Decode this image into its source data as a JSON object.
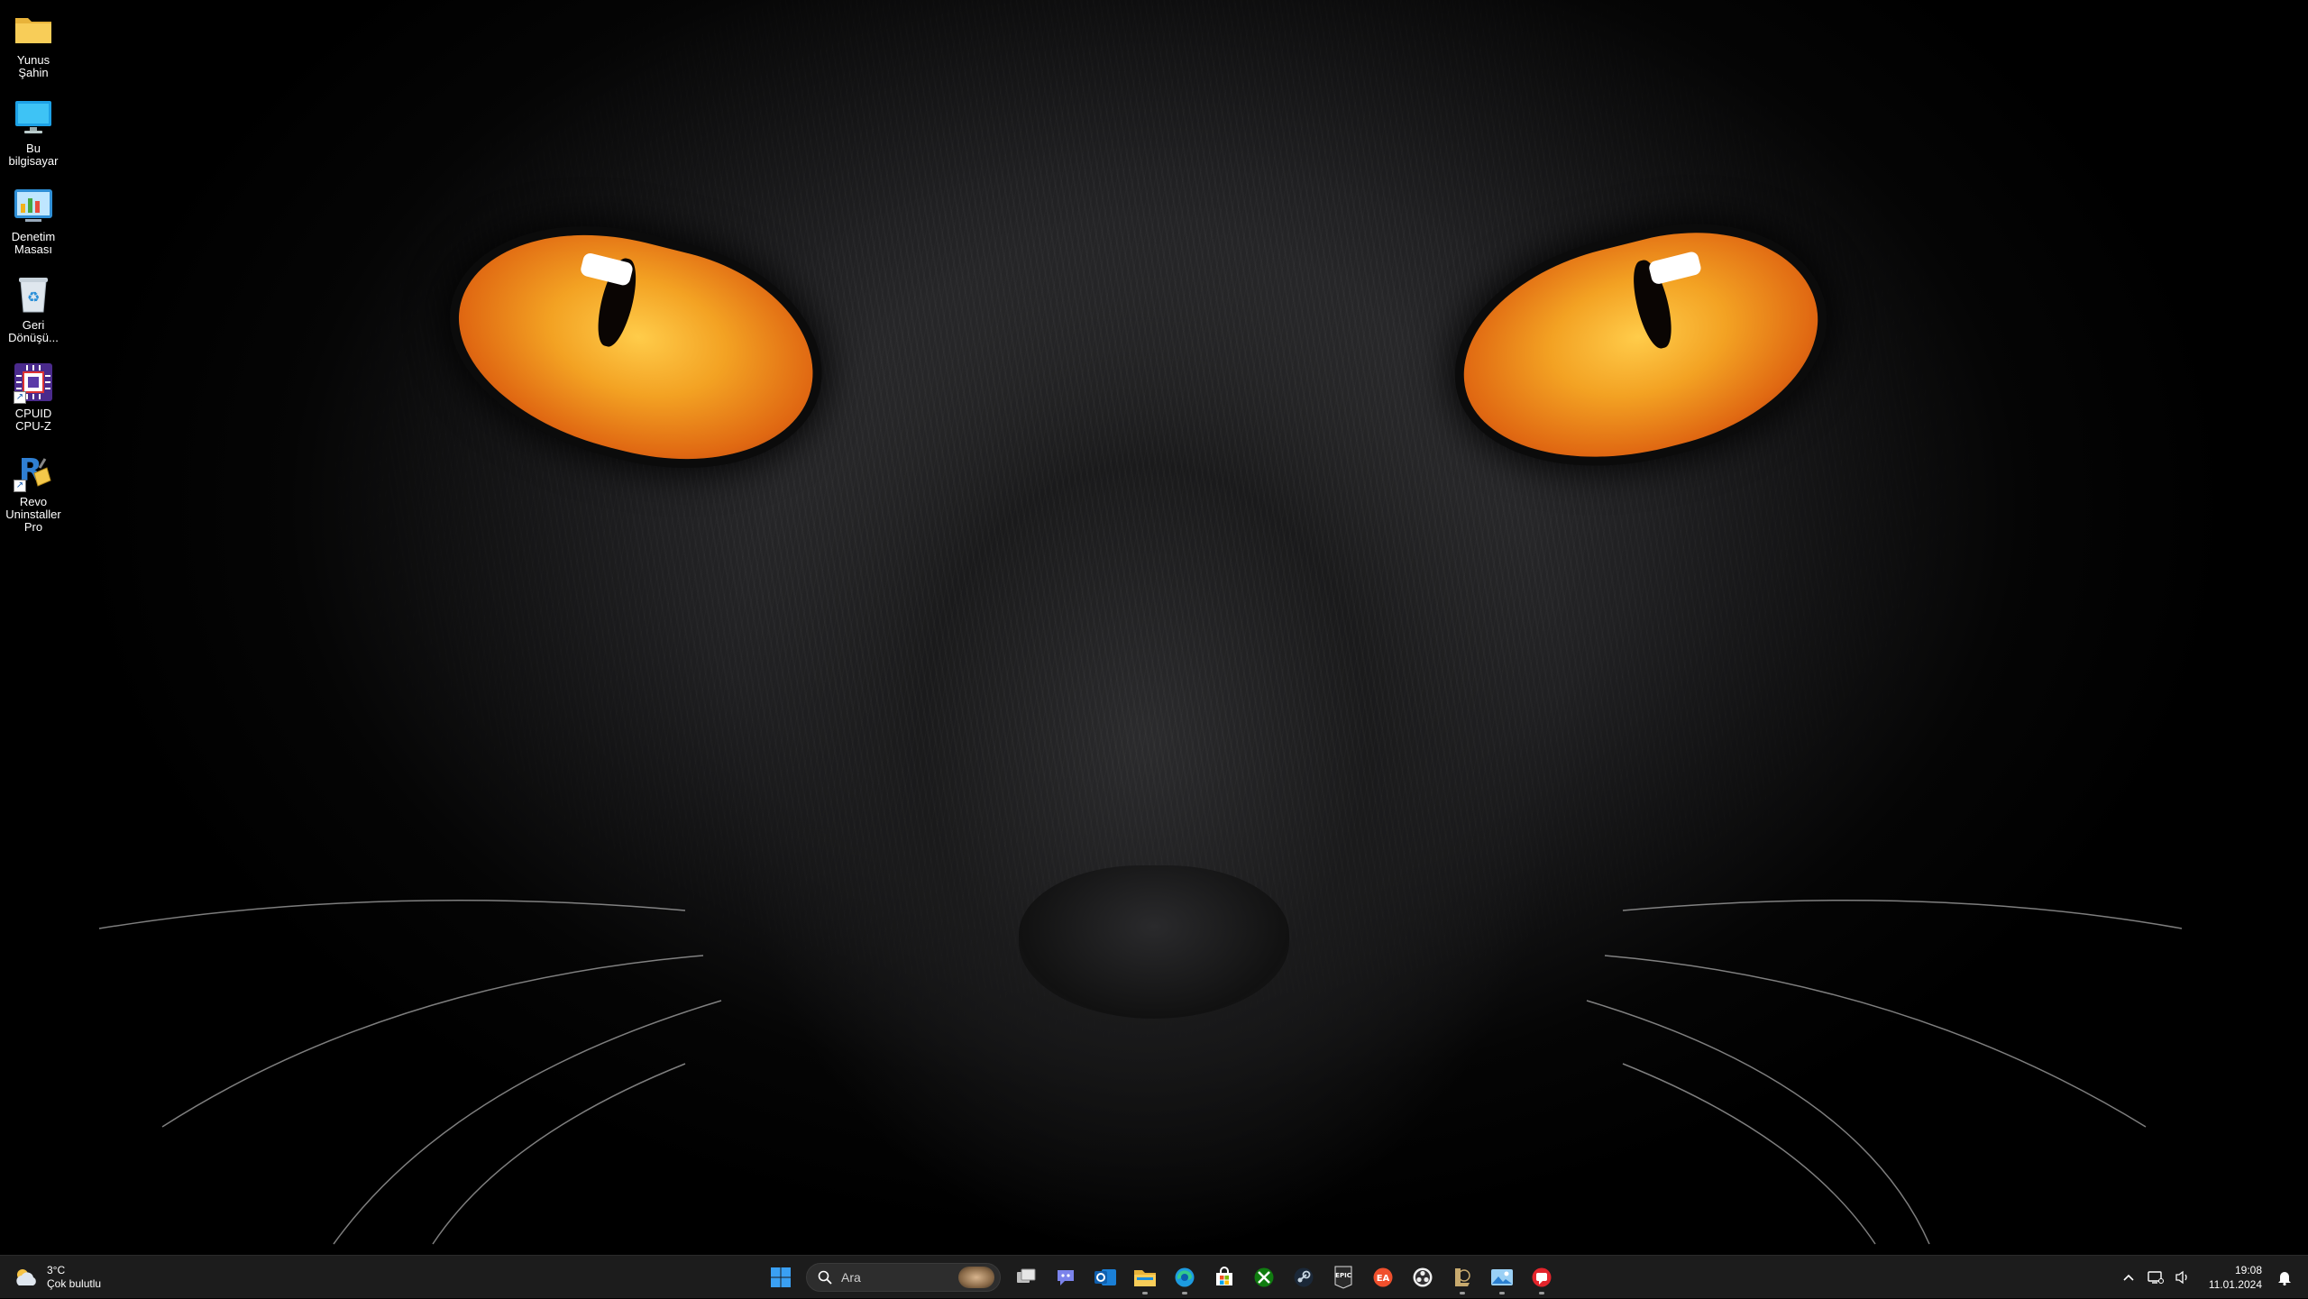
{
  "desktop": {
    "icons": [
      {
        "label": "Yunus Şahin",
        "icon": "folder-icon"
      },
      {
        "label": "Bu bilgisayar",
        "icon": "monitor-icon"
      },
      {
        "label": "Denetim Masası",
        "icon": "control-panel-icon"
      },
      {
        "label": "Geri Dönüşü...",
        "icon": "recycle-bin-icon"
      },
      {
        "label": "CPUID CPU-Z",
        "icon": "cpu-z-icon"
      },
      {
        "label": "Revo Uninstaller Pro",
        "icon": "revo-uninstaller-icon"
      }
    ]
  },
  "taskbar": {
    "weather": {
      "temperature": "3°C",
      "condition": "Çok bulutlu",
      "icon": "cloudy-weather-icon"
    },
    "search": {
      "placeholder": "Ara"
    },
    "apps": [
      {
        "name": "start",
        "icon": "windows-start-icon",
        "running": false
      },
      {
        "name": "task-view",
        "icon": "task-view-icon",
        "running": false
      },
      {
        "name": "teams-chat",
        "icon": "teams-chat-icon",
        "running": false
      },
      {
        "name": "outlook",
        "icon": "outlook-icon",
        "running": false
      },
      {
        "name": "file-explorer",
        "icon": "folder-icon",
        "running": true
      },
      {
        "name": "edge",
        "icon": "edge-browser-icon",
        "running": true
      },
      {
        "name": "microsoft-store",
        "icon": "store-icon",
        "running": false
      },
      {
        "name": "xbox",
        "icon": "xbox-icon",
        "running": false
      },
      {
        "name": "steam",
        "icon": "steam-icon",
        "running": false
      },
      {
        "name": "epic-games",
        "icon": "epic-games-icon",
        "running": false
      },
      {
        "name": "ea-app",
        "icon": "ea-icon",
        "running": false
      },
      {
        "name": "obs",
        "icon": "obs-icon",
        "running": false
      },
      {
        "name": "league-of-legends",
        "icon": "league-icon",
        "running": true
      },
      {
        "name": "photos",
        "icon": "photos-icon",
        "running": true
      },
      {
        "name": "red-app",
        "icon": "red-chat-icon",
        "running": true
      }
    ],
    "tray": {
      "icons": [
        "chevron-up-icon",
        "network-icon",
        "volume-icon"
      ],
      "time": "19:08",
      "date": "11.01.2024",
      "notification_icon": "notification-bell-icon"
    }
  },
  "colors": {
    "taskbar_bg": "#1c1c1c",
    "eye_orange": "#f3a223",
    "accent_blue": "#0a84ff"
  }
}
